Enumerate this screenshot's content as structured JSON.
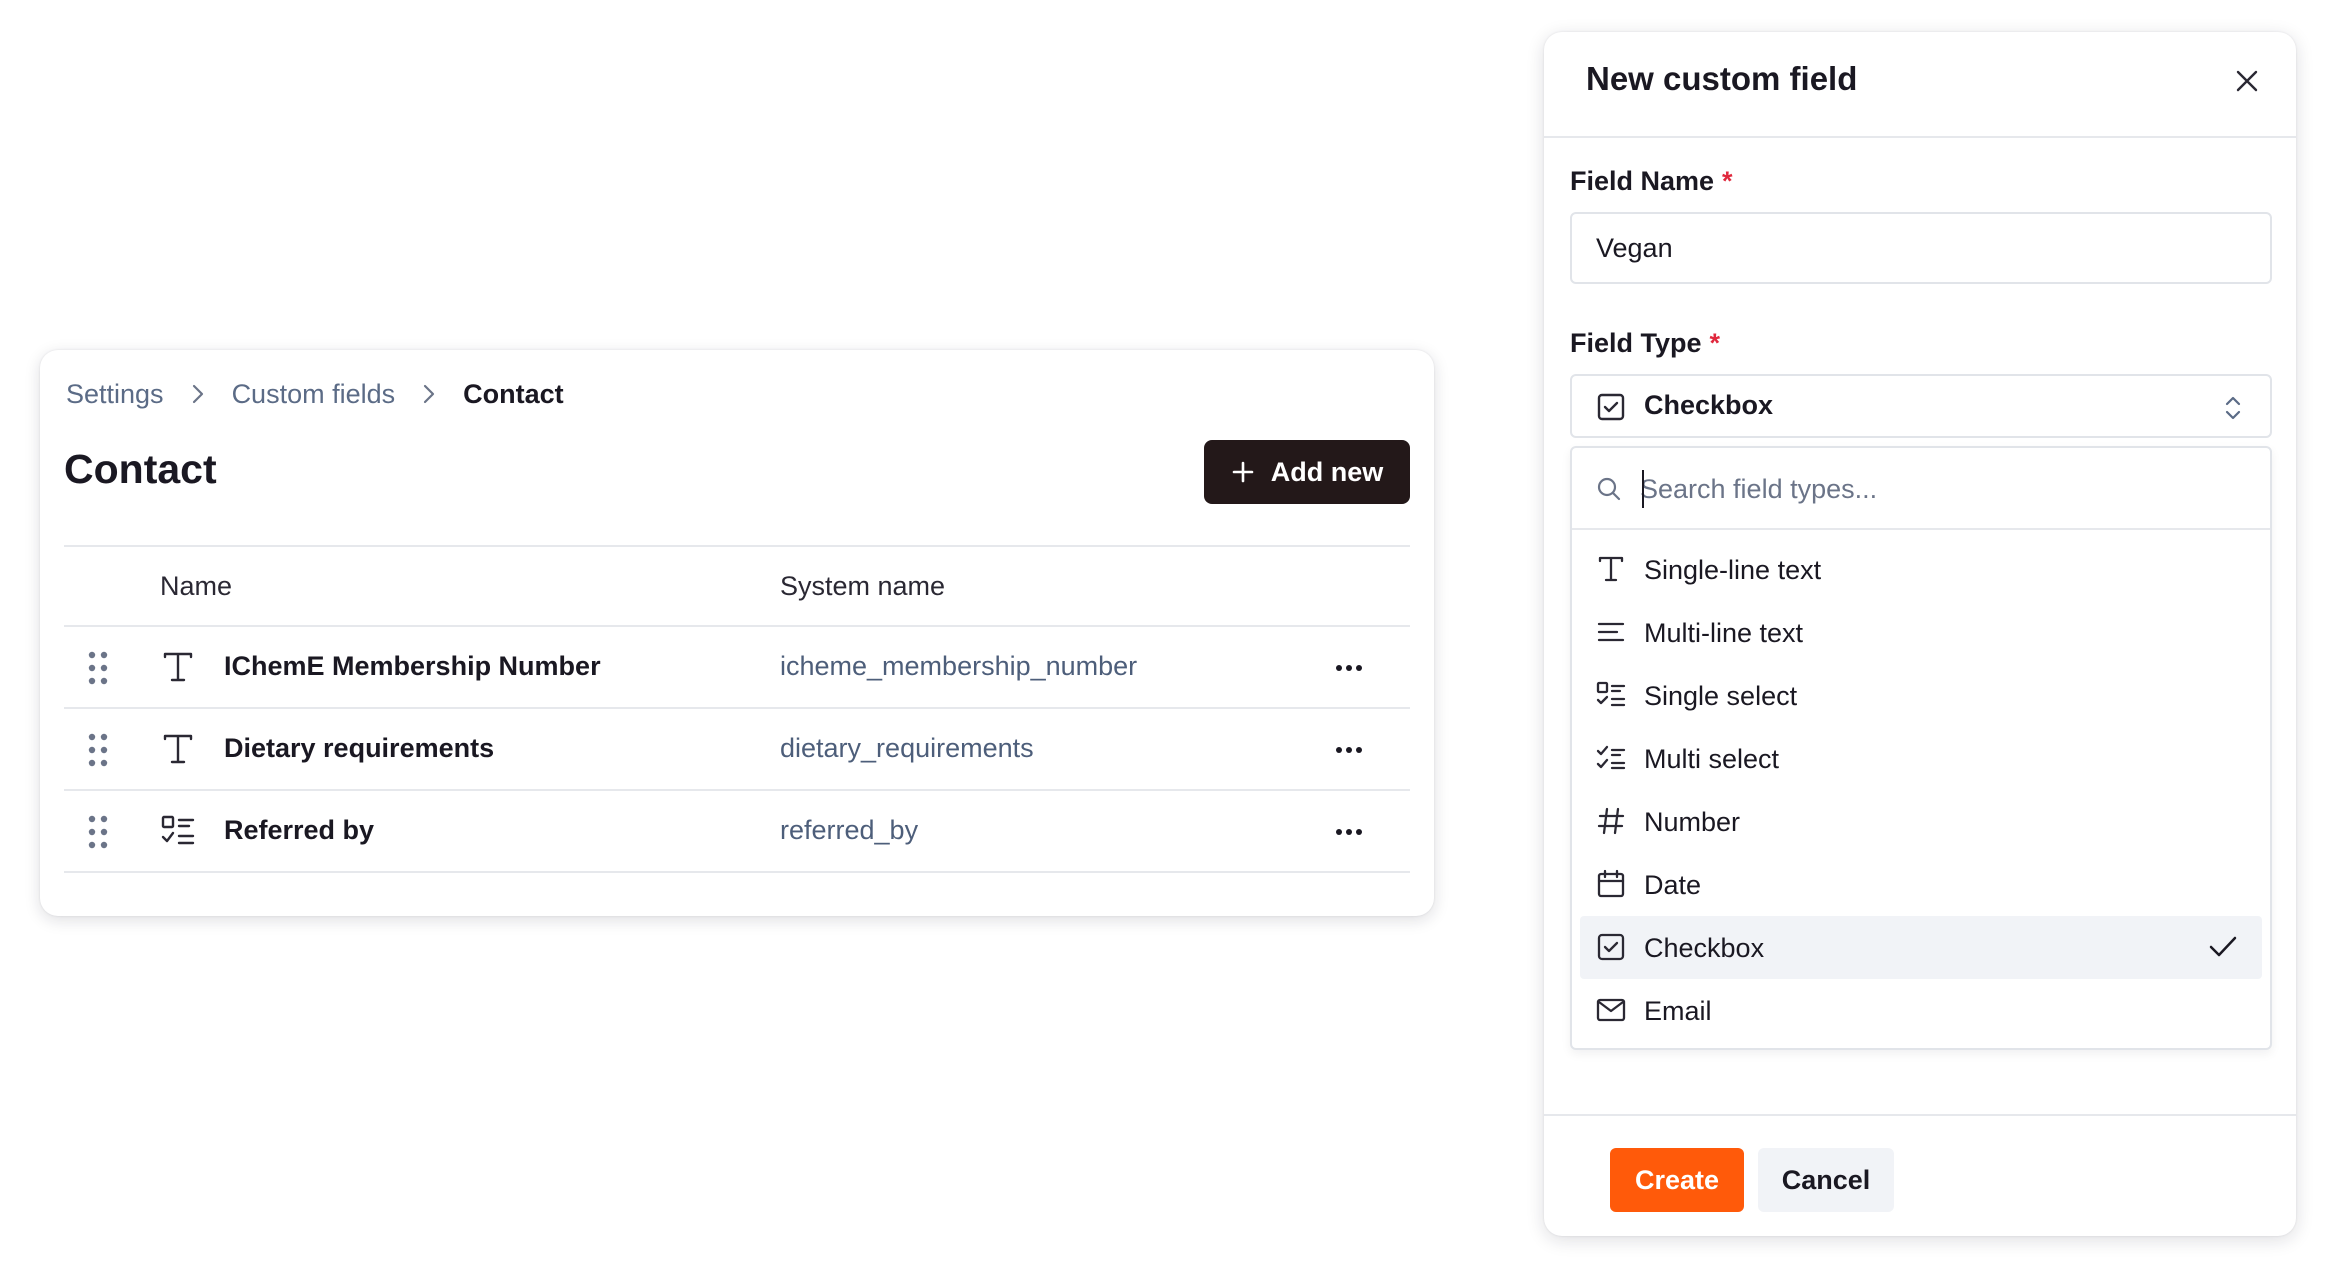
{
  "breadcrumb": {
    "items": [
      "Settings",
      "Custom fields"
    ],
    "current": "Contact"
  },
  "page": {
    "title": "Contact",
    "add_button_label": "Add new"
  },
  "table": {
    "columns": [
      "Name",
      "System name"
    ],
    "rows": [
      {
        "icon": "text-icon",
        "name": "IChemE Membership Number",
        "system_name": "icheme_membership_number"
      },
      {
        "icon": "text-icon",
        "name": "Dietary requirements",
        "system_name": "dietary_requirements"
      },
      {
        "icon": "single-select-icon",
        "name": "Referred by",
        "system_name": "referred_by"
      }
    ]
  },
  "panel": {
    "title": "New custom field",
    "field_name_label": "Field Name",
    "field_name_value": "Vegan",
    "field_type_label": "Field Type",
    "required_marker": "*",
    "field_type_value": "Checkbox",
    "search_placeholder": "Search field types...",
    "options": [
      {
        "label": "Single-line text",
        "icon": "text-icon"
      },
      {
        "label": "Multi-line text",
        "icon": "multiline-icon"
      },
      {
        "label": "Single select",
        "icon": "single-select-icon"
      },
      {
        "label": "Multi select",
        "icon": "multi-select-icon"
      },
      {
        "label": "Number",
        "icon": "hash-icon"
      },
      {
        "label": "Date",
        "icon": "calendar-icon"
      },
      {
        "label": "Checkbox",
        "icon": "checkbox-icon",
        "selected": true
      },
      {
        "label": "Email",
        "icon": "mail-icon"
      }
    ],
    "create_label": "Create",
    "cancel_label": "Cancel"
  },
  "colors": {
    "primary_button": "#231819",
    "accent": "#ff5a0a",
    "required": "#e0283d",
    "link_text": "#5b6b86",
    "selected_bg": "#f1f3f7"
  }
}
